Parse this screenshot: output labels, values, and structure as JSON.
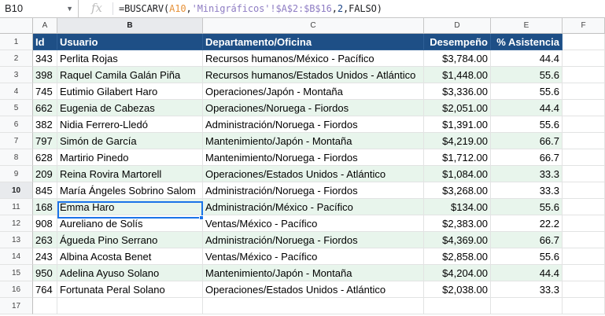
{
  "formula_bar": {
    "name_box": "B10",
    "name_box_caret": "▼",
    "fx_label": "fx",
    "formula_parts": [
      "=BUSCARV(",
      "A10",
      ",",
      "'Minigráficos'!$A$2:$B$16",
      ",",
      "2",
      ",FALSO)"
    ]
  },
  "column_headers": [
    "A",
    "B",
    "C",
    "D",
    "E",
    "F"
  ],
  "row_numbers": [
    "1",
    "2",
    "3",
    "4",
    "5",
    "6",
    "7",
    "8",
    "9",
    "10",
    "11",
    "12",
    "13",
    "14",
    "15",
    "16",
    "17"
  ],
  "selected_cell": "B10",
  "colors": {
    "header_bg": "#1e4f86",
    "band_bg": "#e8f5ec",
    "selection": "#1a73e8"
  },
  "table": {
    "headers": [
      "Id",
      "Usuario",
      "Departamento/Oficina",
      "Desempeño",
      "% Asistencia"
    ],
    "rows": [
      [
        "343",
        "Perlita Rojas",
        "Recursos humanos/México - Pacífico",
        "$3,784.00",
        "44.4"
      ],
      [
        "398",
        "Raquel Camila Galán Piña",
        "Recursos humanos/Estados Unidos - Atlántico",
        "$1,448.00",
        "55.6"
      ],
      [
        "745",
        "Eutimio Gilabert Haro",
        "Operaciones/Japón - Montaña",
        "$3,336.00",
        "55.6"
      ],
      [
        "662",
        "Eugenia de Cabezas",
        "Operaciones/Noruega - Fiordos",
        "$2,051.00",
        "44.4"
      ],
      [
        "382",
        "Nidia Ferrero-Lledó",
        "Administración/Noruega - Fiordos",
        "$1,391.00",
        "55.6"
      ],
      [
        "797",
        "Simón de García",
        "Mantenimiento/Japón - Montaña",
        "$4,219.00",
        "66.7"
      ],
      [
        "628",
        "Martirio Pinedo",
        "Mantenimiento/Noruega - Fiordos",
        "$1,712.00",
        "66.7"
      ],
      [
        "209",
        "Reina Rovira Martorell",
        "Operaciones/Estados Unidos - Atlántico",
        "$1,084.00",
        "33.3"
      ],
      [
        "845",
        "María Ángeles Sobrino Salom",
        "Administración/Noruega - Fiordos",
        "$3,268.00",
        "33.3"
      ],
      [
        "168",
        "Emma Haro",
        "Administración/México - Pacífico",
        "$134.00",
        "55.6"
      ],
      [
        "908",
        "Aureliano de Solís",
        "Ventas/México - Pacífico",
        "$2,383.00",
        "22.2"
      ],
      [
        "263",
        "Águeda Pino Serrano",
        "Administración/Noruega - Fiordos",
        "$4,369.00",
        "66.7"
      ],
      [
        "243",
        "Albina Acosta Benet",
        "Ventas/México - Pacífico",
        "$2,858.00",
        "55.6"
      ],
      [
        "950",
        "Adelina Ayuso Solano",
        "Mantenimiento/Japón - Montaña",
        "$4,204.00",
        "44.4"
      ],
      [
        "764",
        "Fortunata Peral Solano",
        "Operaciones/Estados Unidos - Atlántico",
        "$2,038.00",
        "33.3"
      ]
    ]
  }
}
